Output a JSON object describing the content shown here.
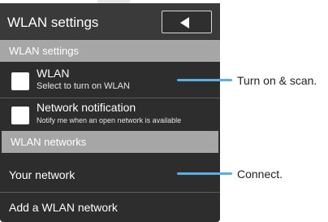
{
  "screen": {
    "title": "WLAN settings",
    "back_button": "back-arrow"
  },
  "sections": [
    {
      "label": "WLAN settings"
    },
    {
      "label": "WLAN networks"
    }
  ],
  "settings": {
    "wlan": {
      "title": "WLAN",
      "summary": "Select to turn on WLAN",
      "checked": false
    },
    "notification": {
      "title": "Network notification",
      "summary": "Notify me when an open network is available",
      "checked": false
    }
  },
  "networks": {
    "your_network": "Your network",
    "add_network": "Add a WLAN network"
  },
  "callouts": {
    "scan": "Turn on & scan.",
    "connect": "Connect."
  },
  "colors": {
    "callout_line": "#5aaee0",
    "screen_bg": "#2d2d2d",
    "section_bg": "#a6a6a6"
  }
}
